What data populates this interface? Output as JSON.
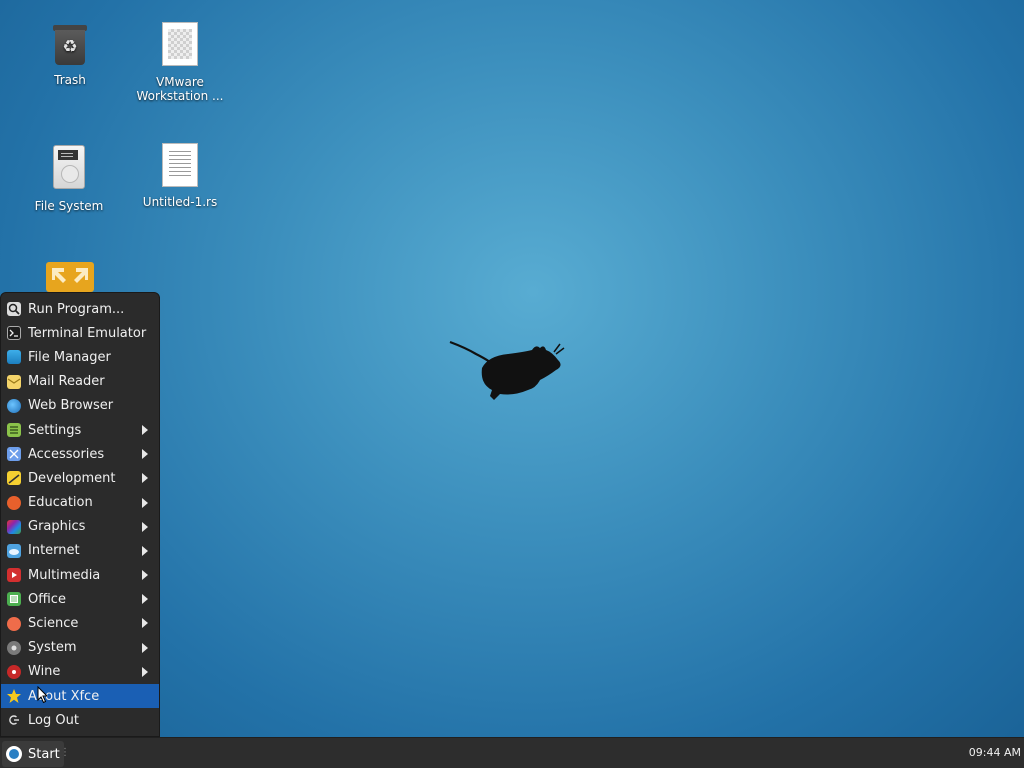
{
  "desktop": {
    "icons": [
      {
        "label": "Trash",
        "icon": "trash-icon"
      },
      {
        "label": "VMware Workstation ...",
        "icon": "document-icon"
      },
      {
        "label": "File System",
        "icon": "drive-icon"
      },
      {
        "label": "Untitled-1.rs",
        "icon": "text-file-icon"
      },
      {
        "label": "",
        "icon": "share-icon"
      }
    ],
    "logo": "xfce-mouse-logo"
  },
  "menu": {
    "items": [
      {
        "label": "Run Program...",
        "icon": "run-icon",
        "submenu": false
      },
      {
        "label": "Terminal Emulator",
        "icon": "terminal-icon",
        "submenu": false
      },
      {
        "label": "File Manager",
        "icon": "folder-icon",
        "submenu": false
      },
      {
        "label": "Mail Reader",
        "icon": "mail-icon",
        "submenu": false
      },
      {
        "label": "Web Browser",
        "icon": "globe-icon",
        "submenu": false
      },
      {
        "label": "Settings",
        "icon": "settings-icon",
        "submenu": true
      },
      {
        "label": "Accessories",
        "icon": "accessories-icon",
        "submenu": true
      },
      {
        "label": "Development",
        "icon": "development-icon",
        "submenu": true
      },
      {
        "label": "Education",
        "icon": "education-icon",
        "submenu": true
      },
      {
        "label": "Graphics",
        "icon": "graphics-icon",
        "submenu": true
      },
      {
        "label": "Internet",
        "icon": "internet-icon",
        "submenu": true
      },
      {
        "label": "Multimedia",
        "icon": "multimedia-icon",
        "submenu": true
      },
      {
        "label": "Office",
        "icon": "office-icon",
        "submenu": true
      },
      {
        "label": "Science",
        "icon": "science-icon",
        "submenu": true
      },
      {
        "label": "System",
        "icon": "system-icon",
        "submenu": true
      },
      {
        "label": "Wine",
        "icon": "wine-icon",
        "submenu": true
      },
      {
        "label": "About Xfce",
        "icon": "star-icon",
        "submenu": false,
        "selected": true
      },
      {
        "label": "Log Out",
        "icon": "logout-icon",
        "submenu": false
      }
    ]
  },
  "taskbar": {
    "start_label": "Start",
    "clock": "09:44 AM"
  },
  "colors": {
    "menu_bg": "#2b2b2b",
    "selection": "#1a5fb4",
    "taskbar_bg": "#2d2d2d"
  }
}
